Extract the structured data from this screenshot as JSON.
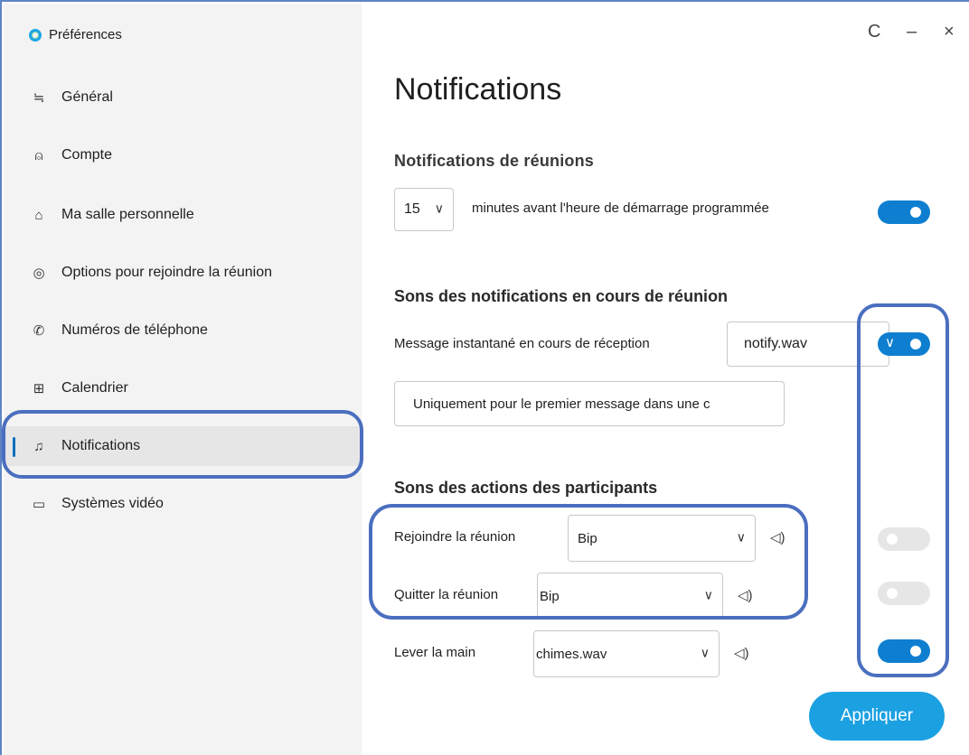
{
  "window": {
    "app_title": "Préférences",
    "controls": {
      "refresh_icon": "C",
      "minimize_icon": "–",
      "close_icon": "×"
    }
  },
  "sidebar": {
    "items": [
      {
        "label": "Général",
        "icon": "sliders-icon",
        "glyph": "≒"
      },
      {
        "label": "Compte",
        "icon": "account-icon",
        "glyph": "⍝"
      },
      {
        "label": "Ma salle personnelle",
        "icon": "room-icon",
        "glyph": "⌂"
      },
      {
        "label": "Options pour rejoindre la réunion",
        "icon": "join-options-icon",
        "glyph": "◎"
      },
      {
        "label": "Numéros de téléphone",
        "icon": "phone-icon",
        "glyph": "✆"
      },
      {
        "label": "Calendrier",
        "icon": "calendar-icon",
        "glyph": "⊞"
      },
      {
        "label": "Notifications",
        "icon": "bell-icon",
        "glyph": "♫",
        "active": true
      },
      {
        "label": "Systèmes vidéo",
        "icon": "video-systems-icon",
        "glyph": "▭"
      }
    ]
  },
  "main": {
    "title": "Notifications",
    "meeting_notifications": {
      "heading": "Notifications de réunions",
      "minutes_value": "15",
      "minutes_label": "minutes avant l'heure de démarrage programmée",
      "enabled": true
    },
    "in_meeting_sounds": {
      "heading": "Sons des notifications en cours de réunion",
      "instant_message_label": "Message instantané en cours de réception",
      "instant_message_sound": "notify.wav",
      "instant_message_enabled": true,
      "frequency_option": "Uniquement pour le premier message dans une c"
    },
    "participant_sounds": {
      "heading": "Sons des actions des participants",
      "rows": [
        {
          "label": "Rejoindre la réunion",
          "sound": "Bip",
          "enabled": false
        },
        {
          "label": "Quitter la réunion",
          "sound": "Bip",
          "enabled": false
        },
        {
          "label": "Lever la main",
          "sound": "chimes.wav",
          "enabled": true
        }
      ]
    },
    "apply_label": "Appliquer"
  },
  "colors": {
    "accent": "#0e7fd0",
    "apply_button": "#1ba0e2",
    "highlight_border": "#4a6fbf",
    "sidebar_bg": "#f3f3f3"
  }
}
